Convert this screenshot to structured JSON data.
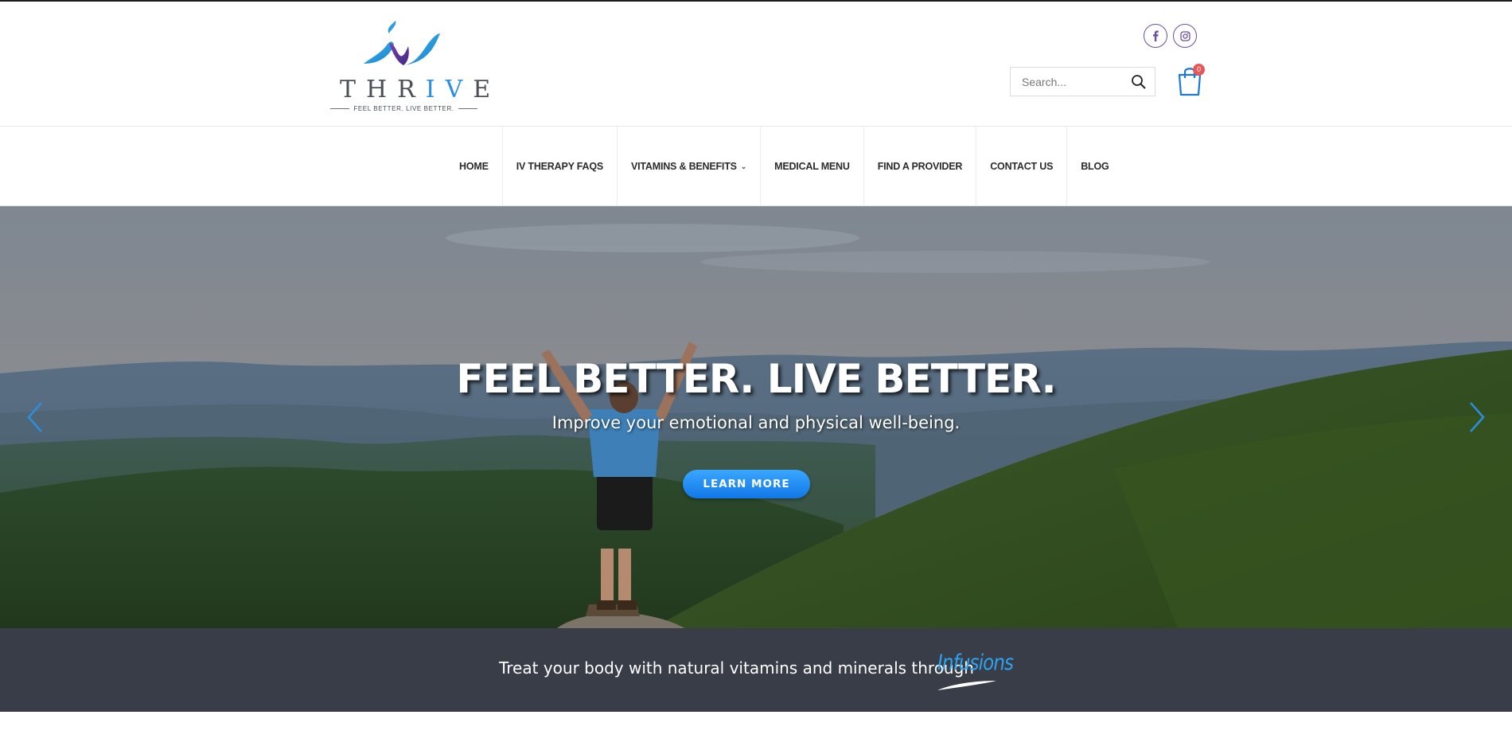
{
  "brand": {
    "name_parts": [
      "THR",
      "IV",
      "E"
    ],
    "tagline": "FEEL BETTER. LIVE BETTER.",
    "accent_color": "#2a8fe0",
    "purple_color": "#6c4ea1"
  },
  "header": {
    "social": [
      {
        "name": "facebook-icon",
        "glyph": "f"
      },
      {
        "name": "instagram-icon"
      }
    ],
    "search": {
      "placeholder": "Search..."
    },
    "cart": {
      "count": "0"
    }
  },
  "nav": {
    "items": [
      {
        "label": "HOME"
      },
      {
        "label": "IV THERAPY FAQS"
      },
      {
        "label": "VITAMINS & BENEFITS",
        "has_dropdown": true
      },
      {
        "label": "MEDICAL MENU"
      },
      {
        "label": "FIND A PROVIDER"
      },
      {
        "label": "CONTACT US"
      },
      {
        "label": "BLOG"
      }
    ]
  },
  "hero": {
    "title": "FEEL BETTER. LIVE BETTER.",
    "subtitle": "Improve your emotional and physical well-being.",
    "cta_label": "LEARN MORE",
    "prev_icon": "chevron-left-icon",
    "next_icon": "chevron-right-icon"
  },
  "band": {
    "text": "Treat your body with natural vitamins and minerals through",
    "script_word": "Infusions",
    "background": "#383d48"
  }
}
